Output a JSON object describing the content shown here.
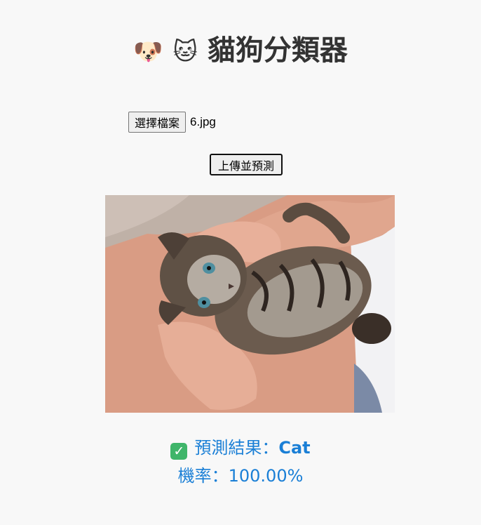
{
  "header": {
    "dog_emoji": "🐶",
    "cat_emoji": "🐱",
    "title": "貓狗分類器"
  },
  "upload": {
    "choose_file_label": "選擇檔案",
    "file_name": "6.jpg",
    "submit_label": "上傳並預測"
  },
  "preview": {
    "image_subject": "kitten-being-held-photo"
  },
  "result": {
    "check_icon": "✓",
    "prediction_prefix": "預測結果：",
    "prediction_label": "Cat",
    "probability_text": "機率：100.00%"
  },
  "colors": {
    "result_text": "#1a7fd6",
    "check_icon": "#3fb56a",
    "page_background": "#f8f8f8"
  }
}
